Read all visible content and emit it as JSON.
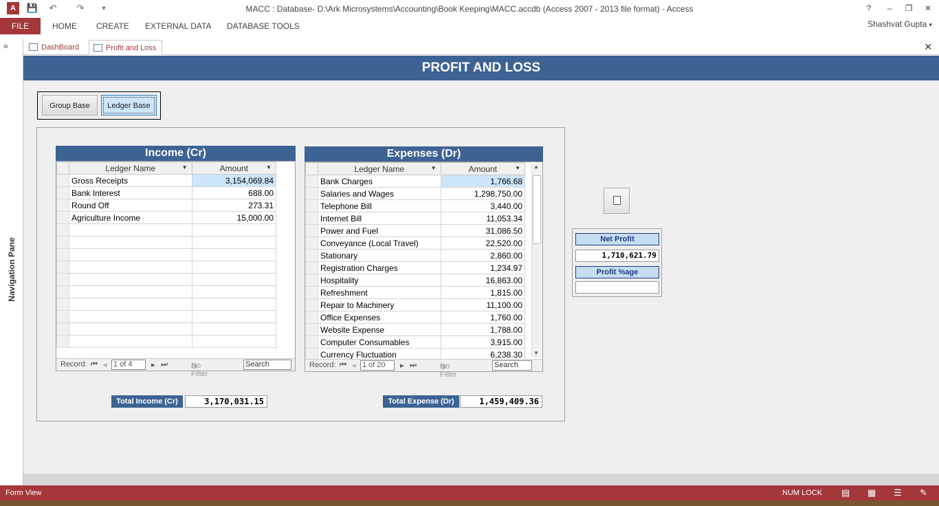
{
  "window": {
    "title": "MACC : Database- D:\\Ark Microsystems\\Accounting\\Book Keeping\\MACC.accdb (Access 2007 - 2013 file format) - Access",
    "help": "?",
    "minimize": "–",
    "restore": "❐",
    "close": "✕",
    "user": "Shashvat Gupta"
  },
  "ribbon": {
    "file": "FILE",
    "tabs": [
      "HOME",
      "CREATE",
      "EXTERNAL DATA",
      "DATABASE TOOLS"
    ]
  },
  "nav_pane": {
    "toggle": "»",
    "label": "Navigation Pane"
  },
  "doc_tabs": [
    "DashBoard",
    "Profit and Loss"
  ],
  "form": {
    "title": "PROFIT AND LOSS",
    "toggle_buttons": {
      "group": "Group Base",
      "ledger": "Ledger Base"
    },
    "income": {
      "title": "Income (Cr)",
      "columns": [
        "Ledger Name",
        "Amount"
      ],
      "rows": [
        [
          "Gross Receipts",
          "3,154,069.84"
        ],
        [
          "Bank Interest",
          "688.00"
        ],
        [
          "Round Off",
          "273.31"
        ],
        [
          "Agriculture Income",
          "15,000.00"
        ]
      ],
      "nav": {
        "record_label": "Record:",
        "position": "1 of 4",
        "filter": "No Filter",
        "search": "Search"
      },
      "total_label": "Total Income (Cr)",
      "total_value": "3,170,031.15"
    },
    "expenses": {
      "title": "Expenses (Dr)",
      "columns": [
        "Ledger Name",
        "Amount"
      ],
      "rows": [
        [
          "Bank Charges",
          "1,766.68"
        ],
        [
          "Salaries and Wages",
          "1,298,750.00"
        ],
        [
          "Telephone Bill",
          "3,440.00"
        ],
        [
          "Internet Bill",
          "11,053.34"
        ],
        [
          "Power and Fuel",
          "31,086.50"
        ],
        [
          "Conveyance (Local Travel)",
          "22,520.00"
        ],
        [
          "Stationary",
          "2,860.00"
        ],
        [
          "Registration Charges",
          "1,234.97"
        ],
        [
          "Hospitality",
          "16,863.00"
        ],
        [
          "Refreshment",
          "1,815.00"
        ],
        [
          "Repair to Machinery",
          "11,100.00"
        ],
        [
          "Office Expenses",
          "1,760.00"
        ],
        [
          "Website Expense",
          "1,788.00"
        ],
        [
          "Computer Consumables",
          "3,915.00"
        ],
        [
          "Currency Fluctuation",
          "6,238.30"
        ]
      ],
      "nav": {
        "record_label": "Record:",
        "position": "1 of 20",
        "filter": "No Filter",
        "search": "Search"
      },
      "total_label": "Total Expense (Dr)",
      "total_value": "1,459,409.36"
    },
    "net_profit": {
      "label": "Net Profit",
      "value": "1,710,621.79",
      "pct_label": "Profit %age",
      "pct_value": ""
    }
  },
  "status": {
    "left": "Form View",
    "numlock": "NUM LOCK"
  },
  "colors": {
    "accent": "#a4373a",
    "header": "#3d6394",
    "highlight": "#cde6fb"
  }
}
